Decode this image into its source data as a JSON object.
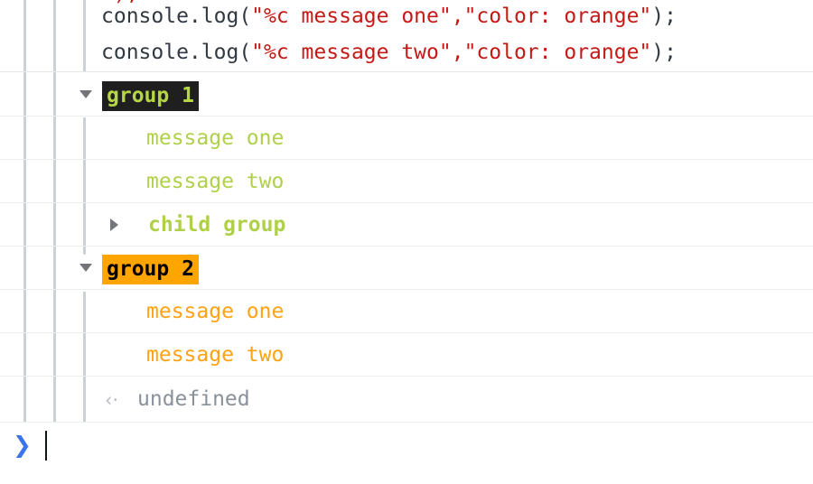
{
  "app": {
    "name": "browser-devtools-console",
    "theme": "light"
  },
  "colors": {
    "background": "#ffffff",
    "row_separator": "#eceff1",
    "guide_rail": "#cdd0d4",
    "code_text": "#303942",
    "string_literal": "#c41a16",
    "group1_label_bg": "#1f1f1f",
    "group1_label_fg": "#b6d644",
    "group2_label_bg": "#ffa500",
    "group2_label_fg": "#000000",
    "message_green": "#b0d04a",
    "message_orange": "#ffa213",
    "undefined_gray": "#89919a",
    "return_icon_gray": "#b7bbbf",
    "prompt_blue": "#3a74e8",
    "triangle_gray": "#737578",
    "caret": "#111418"
  },
  "echoed_code": {
    "clipped_line": "\");",
    "lines": [
      {
        "prefix": "console.log(",
        "string": "\"%c message one\",\"color: orange\"",
        "suffix": ");"
      },
      {
        "prefix": "console.log(",
        "string": "\"%c message two\",\"color: orange\"",
        "suffix": ");"
      }
    ]
  },
  "log_entries": [
    {
      "kind": "group-header",
      "label": "group 1",
      "expanded": true,
      "disclosure_icon": "triangle-down-icon",
      "style": "dark-badge"
    },
    {
      "kind": "message",
      "label": "message one",
      "style": "green",
      "depth": 1
    },
    {
      "kind": "message",
      "label": "message two",
      "style": "green",
      "depth": 1
    },
    {
      "kind": "group-header",
      "label": "child group",
      "expanded": false,
      "disclosure_icon": "triangle-right-icon",
      "style": "green-plain",
      "depth": 1
    },
    {
      "kind": "group-header",
      "label": "group 2",
      "expanded": true,
      "disclosure_icon": "triangle-down-icon",
      "style": "orange-badge"
    },
    {
      "kind": "message",
      "label": "message one",
      "style": "orange",
      "depth": 1
    },
    {
      "kind": "message",
      "label": "message two",
      "style": "orange",
      "depth": 1
    },
    {
      "kind": "return-value",
      "icon": "return-arrow-icon",
      "icon_glyph": "‹·",
      "label": "undefined"
    }
  ],
  "prompt": {
    "chevron": "❯",
    "value": "",
    "placeholder": ""
  }
}
